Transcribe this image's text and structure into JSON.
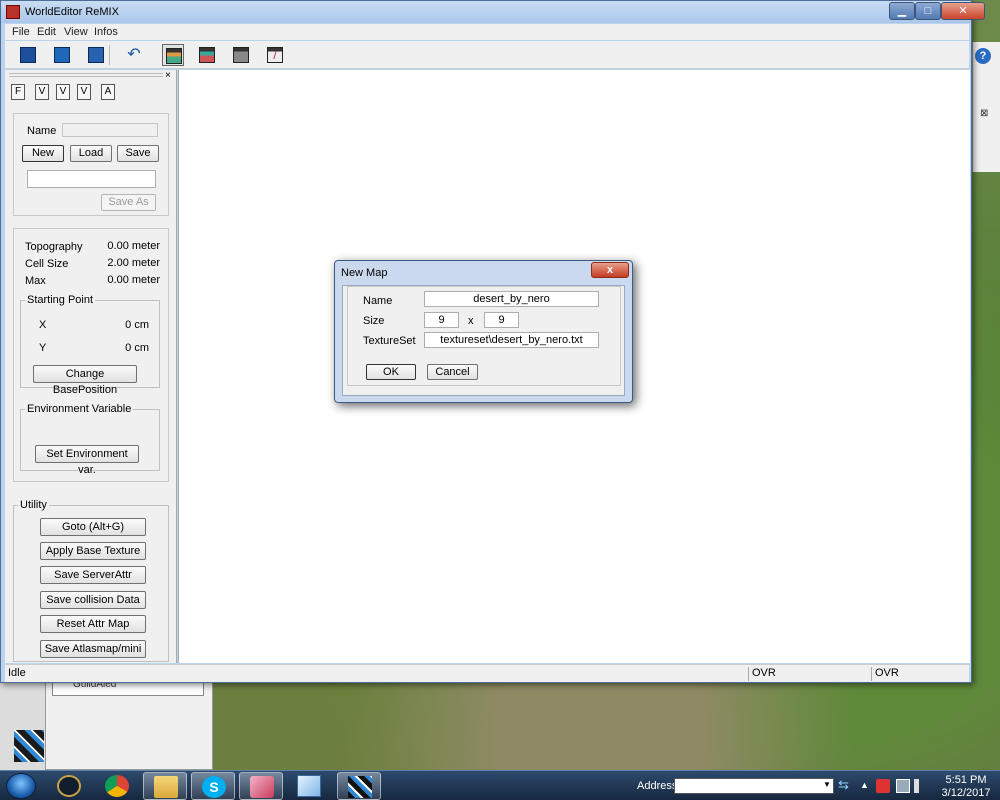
{
  "desktop": {
    "help_glyph": "?",
    "close_glyph": "⊠",
    "bg_item_label": "GuildAied"
  },
  "window": {
    "title": "WorldEditor ReMIX",
    "min_glyph": "▁",
    "max_glyph": "□",
    "close_glyph": "✕"
  },
  "menu": [
    "File",
    "Edit",
    "View",
    "Infos"
  ],
  "toolbar": {
    "icons": [
      "new-document-icon",
      "open-folder-icon",
      "save-disk-icon",
      "undo-icon",
      "map-view-icon",
      "texture-view-icon",
      "object-view-icon",
      "paint-brush-icon"
    ]
  },
  "panel": {
    "close_glyph": "×",
    "tabs": [
      "F",
      "V",
      "V",
      "V",
      "A"
    ],
    "name_label": "Name",
    "name_value": "",
    "new_btn": "New",
    "load_btn": "Load",
    "save_btn": "Save",
    "path_value": "",
    "save_as_btn": "Save As",
    "info": {
      "topography_label": "Topography",
      "topography_value": "0.00 meter",
      "cell_label": "Cell Size",
      "cell_value": "2.00 meter",
      "max_label": "Max",
      "max_value": "0.00 meter"
    },
    "starting_point": {
      "legend": "Starting Point",
      "x_label": "X",
      "x_value": "0 cm",
      "y_label": "Y",
      "y_value": "0 cm",
      "change_btn": "Change BasePosition"
    },
    "environment": {
      "legend": "Environment Variable",
      "set_btn": "Set Environment var."
    },
    "utility": {
      "legend": "Utility",
      "buttons": [
        "Goto (Alt+G)",
        "Apply Base Texture",
        "Save ServerAttr",
        "Save collision Data",
        "Reset Attr Map",
        "Save Atlasmap/mini"
      ]
    }
  },
  "statusbar": {
    "status": "Idle",
    "cell2": "OVR",
    "cell3": "OVR"
  },
  "dialog": {
    "title": "New Map",
    "close_glyph": "x",
    "name_label": "Name",
    "name_value": "desert_by_nero",
    "size_label": "Size",
    "size_w": "9",
    "size_sep": "x",
    "size_h": "9",
    "texture_label": "TextureSet",
    "texture_value": "textureset\\desert_by_nero.txt",
    "ok_btn": "OK",
    "cancel_btn": "Cancel"
  },
  "taskbar": {
    "address_label": "Address",
    "address_value": "",
    "address_drop": "▼",
    "go_glyph": "⇆",
    "tray_up": "▲",
    "time": "5:51 PM",
    "date": "3/12/2017",
    "apps": [
      "league-of-legends-icon",
      "chrome-icon",
      "file-explorer-icon",
      "skype-icon",
      "game-launcher-icon",
      "notepad-icon",
      "world-editor-icon"
    ]
  }
}
